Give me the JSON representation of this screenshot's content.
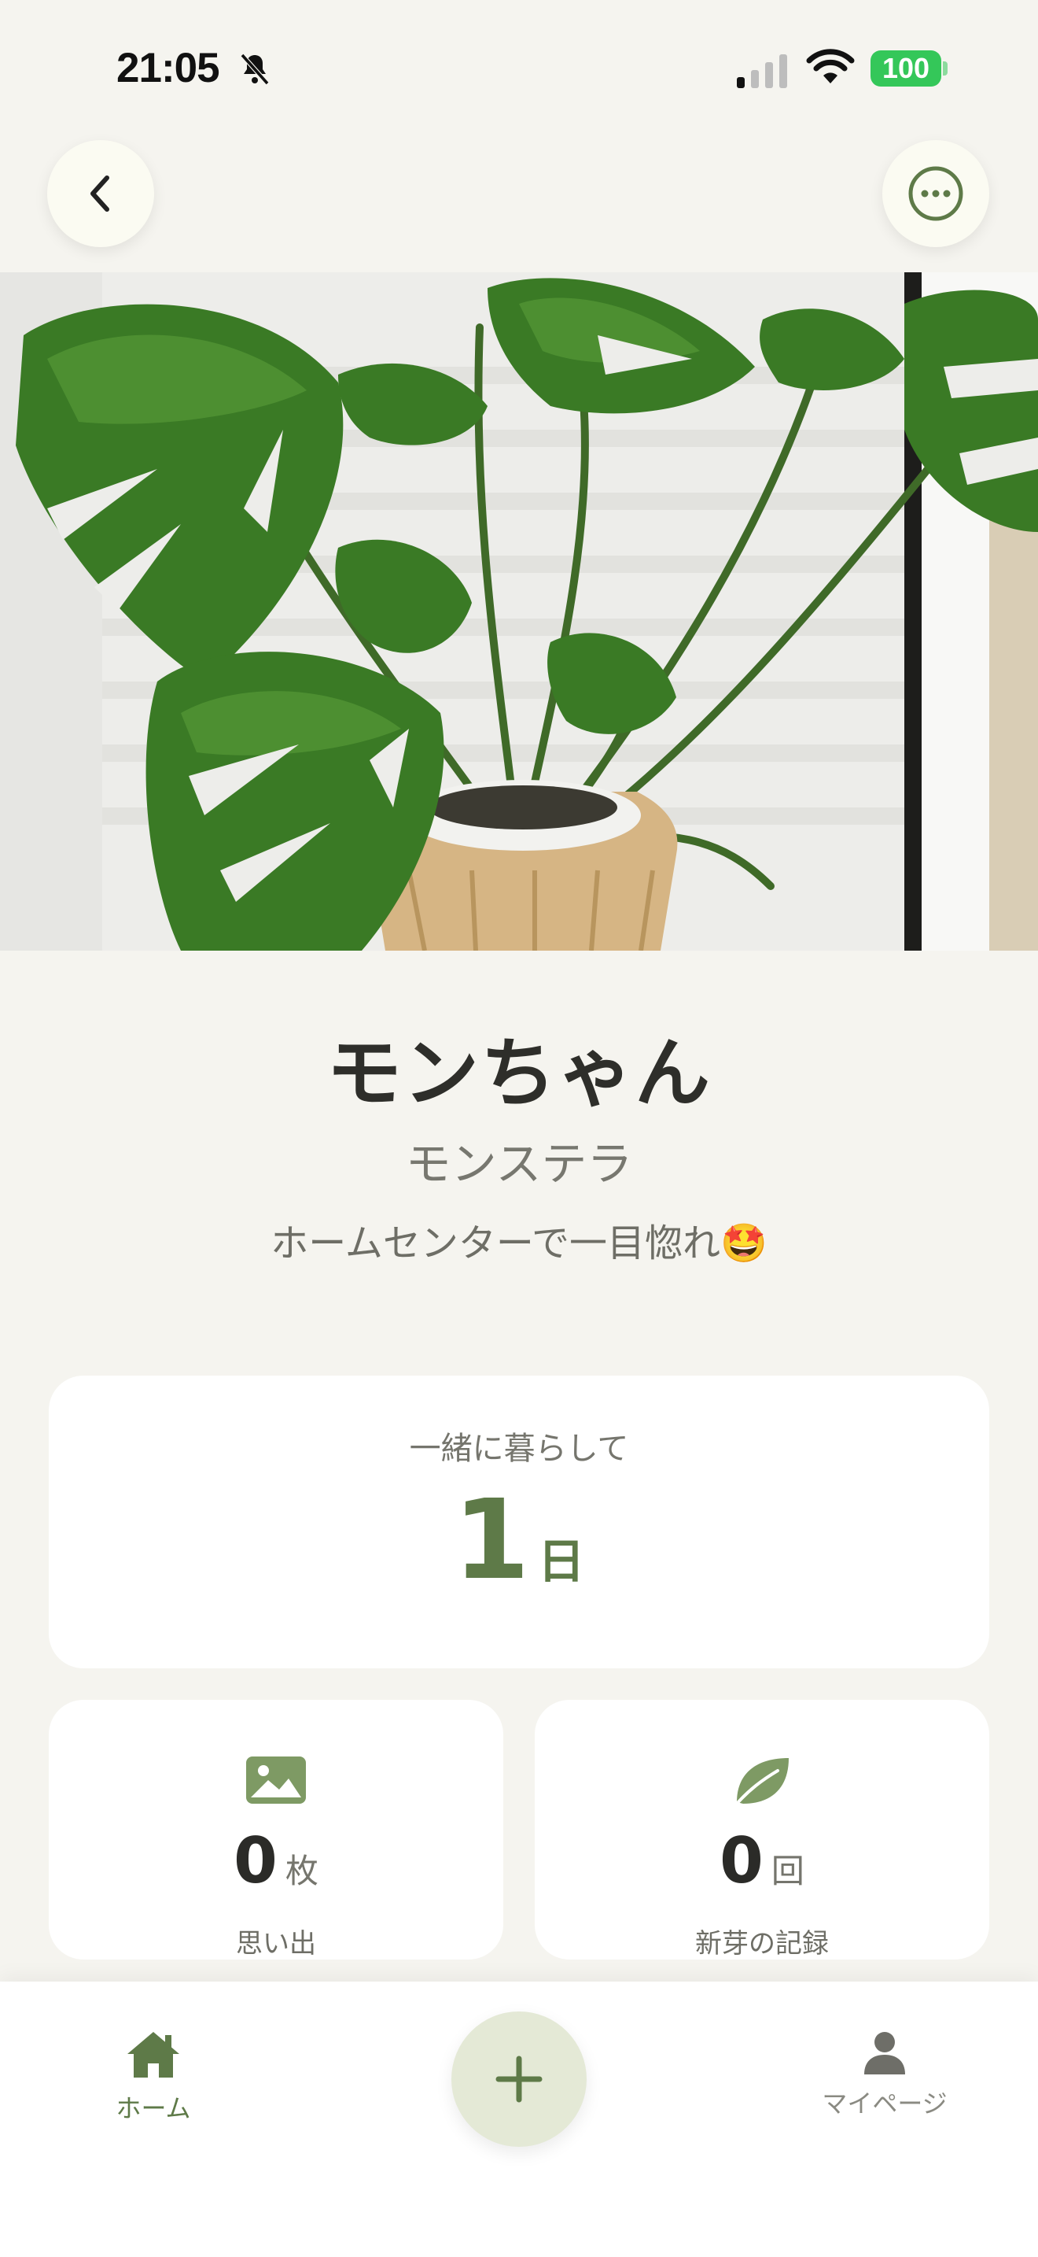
{
  "status_bar": {
    "time": "21:05",
    "battery": "100",
    "icons": [
      "bell-slash-icon",
      "signal-icon",
      "wifi-icon",
      "battery-icon"
    ]
  },
  "header": {
    "back_icon": "chevron-left-icon",
    "more_icon": "ellipsis-circle-icon"
  },
  "plant": {
    "name": "モンちゃん",
    "species": "モンステラ",
    "note": "ホームセンターで一目惚れ🤩"
  },
  "together": {
    "label": "一緒に暮らして",
    "value": "1",
    "unit": "日"
  },
  "stats": [
    {
      "icon": "photo-icon",
      "value": "0",
      "unit": "枚",
      "label": "思い出"
    },
    {
      "icon": "leaf-icon",
      "value": "0",
      "unit": "回",
      "label": "新芽の記録"
    }
  ],
  "tab_bar": {
    "home_label": "ホーム",
    "add_icon": "plus-icon",
    "mypage_label": "マイページ"
  },
  "colors": {
    "background": "#F5F4EF",
    "accent": "#5E7A48",
    "card": "#FFFFFF",
    "add_button": "#E4E9D6"
  }
}
